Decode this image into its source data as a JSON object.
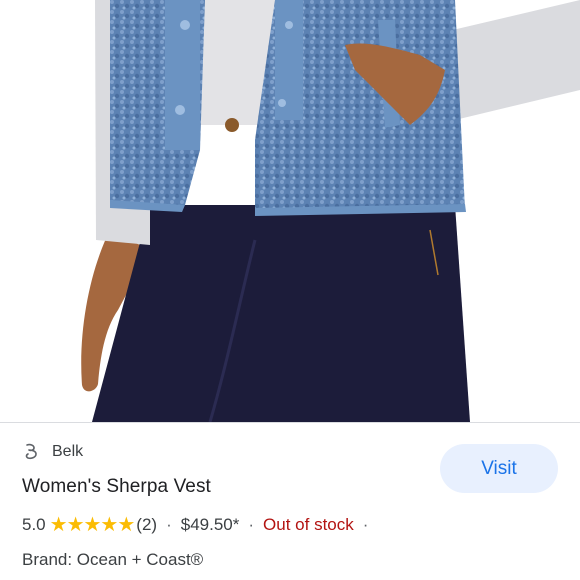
{
  "product": {
    "store_name": "Belk",
    "title": "Women's Sherpa Vest",
    "rating": "5.0",
    "stars": "★★★★★",
    "review_count": "(2)",
    "price": "$49.50*",
    "stock_status": "Out of stock",
    "brand": "Brand: Ocean + Coast®"
  },
  "actions": {
    "visit_label": "Visit"
  },
  "separators": {
    "dot": "·"
  },
  "colors": {
    "link_blue": "#1a73e8",
    "button_bg": "#e8f0fe",
    "star_gold": "#fbbc04",
    "out_of_stock_red": "#b31412"
  }
}
